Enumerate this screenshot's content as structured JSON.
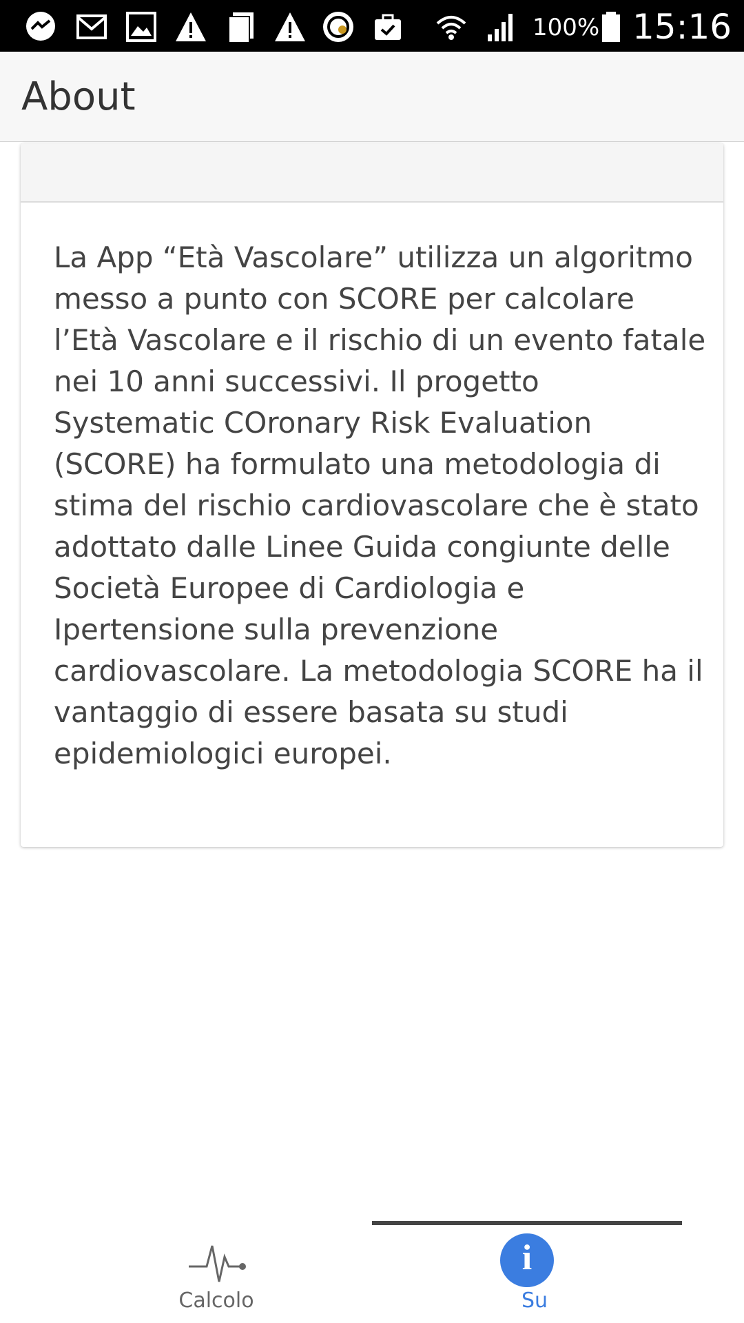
{
  "status_bar": {
    "icons": [
      "messenger-icon",
      "gmail-icon",
      "gallery-icon",
      "warning-icon",
      "copy-icon",
      "warning-icon",
      "app-badge-icon",
      "briefcase-check-icon",
      "wifi-icon",
      "signal-icon",
      "battery-icon"
    ],
    "battery_percent": "100%",
    "time": "15:16"
  },
  "header": {
    "title": "About"
  },
  "card": {
    "body": "La App “Età Vascolare” utilizza un algoritmo messo a punto con SCORE per calcolare l’Età Vascolare e il rischio di un evento fatale nei 10 anni successivi. Il progetto Systematic COronary Risk Evaluation (SCORE) ha formulato una metodologia di stima del rischio cardiovascolare che è stato adottato dalle Linee Guida congiunte delle Società Europee di Cardiologia e Ipertensione sulla prevenzione cardiovascolare. La metodologia SCORE ha il vantaggio di essere basata su studi epidemiologici europei."
  },
  "tabs": [
    {
      "label": "Calcolo",
      "icon": "heartbeat-icon",
      "selected": false
    },
    {
      "label": "Su",
      "icon": "info-icon",
      "selected": true
    }
  ],
  "colors": {
    "accent": "#3b7de0",
    "status_bar": "#000000",
    "header_bg": "#f7f7f7"
  },
  "info_glyph": "i"
}
